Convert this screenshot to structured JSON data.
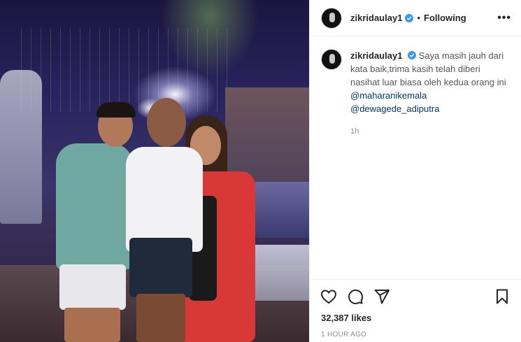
{
  "post": {
    "username": "zikridaulay1",
    "following_label": "Following",
    "dot": "•",
    "more_label": "•••",
    "caption": {
      "username": "zikridaulay1",
      "text": "Saya masih jauh dari kata baik,trima kasih telah diberi nasihat luar biasa oleh kedua orang ini",
      "mention_1": "@maharanikemala",
      "mention_2": "@dewagede_adiputra"
    },
    "caption_time": "1h",
    "likes": "32,387 likes",
    "posted": "1 HOUR AGO",
    "colors": {
      "verified": "#3897f0",
      "mention": "#00376b"
    },
    "icons": [
      "heart-icon",
      "comment-icon",
      "share-icon",
      "bookmark-icon",
      "verified-icon"
    ]
  }
}
